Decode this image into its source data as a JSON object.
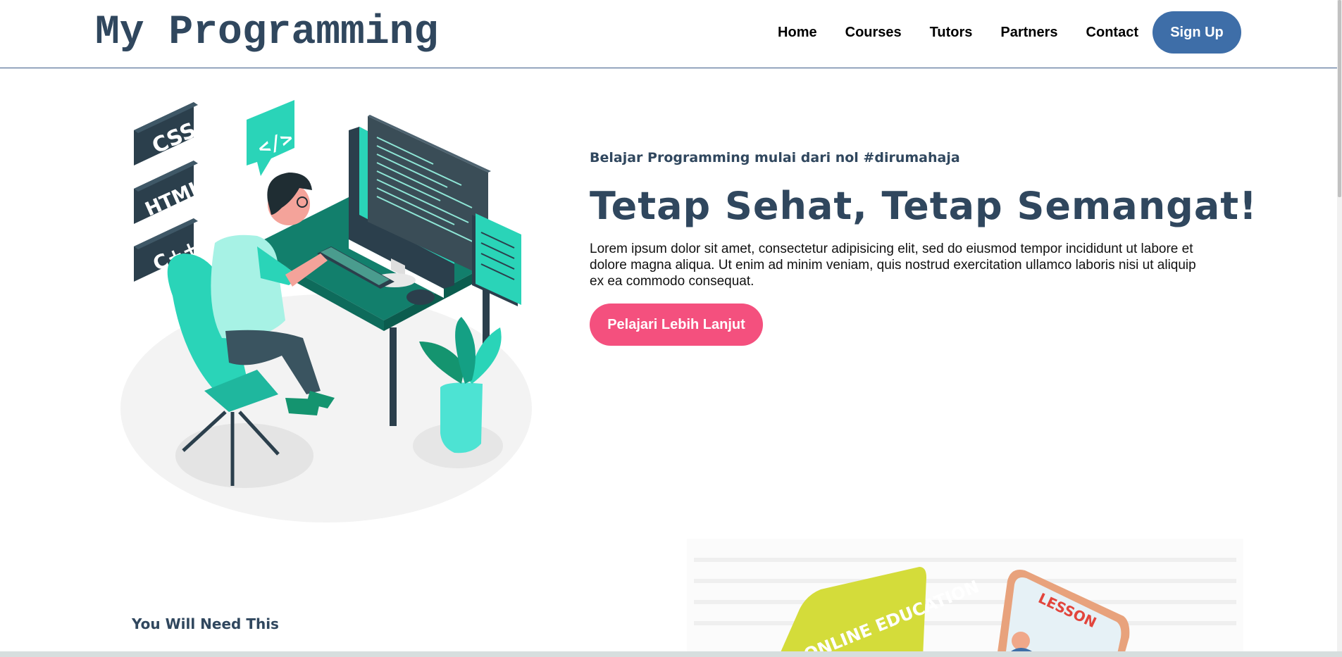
{
  "header": {
    "logo": "My Programming",
    "nav": [
      "Home",
      "Courses",
      "Tutors",
      "Partners",
      "Contact"
    ],
    "signup_label": "Sign Up"
  },
  "hero": {
    "tagline": "Belajar Programming mulai dari nol #dirumahaja",
    "headline": "Tetap Sehat, Tetap Semangat!",
    "body": "Lorem ipsum dolor sit amet, consectetur adipisicing elit, sed do eiusmod tempor incididunt ut labore et dolore magna aliqua. Ut enim ad minim veniam, quis nostrud exercitation ullamco laboris nisi ut aliquip ex ea commodo consequat.",
    "cta_label": "Pelajari Lebih Lanjut",
    "illustration_tags": [
      "CSS",
      "HTML",
      "C++",
      "</>"
    ]
  },
  "features": {
    "title": "You Will Need This",
    "card1_text": "ONLINE EDUCATION",
    "card2_text": "LESSON"
  },
  "colors": {
    "brand": "#30475e",
    "signup": "#3e6ea8",
    "cta": "#f4507e",
    "accent": "#2ad4b8"
  }
}
